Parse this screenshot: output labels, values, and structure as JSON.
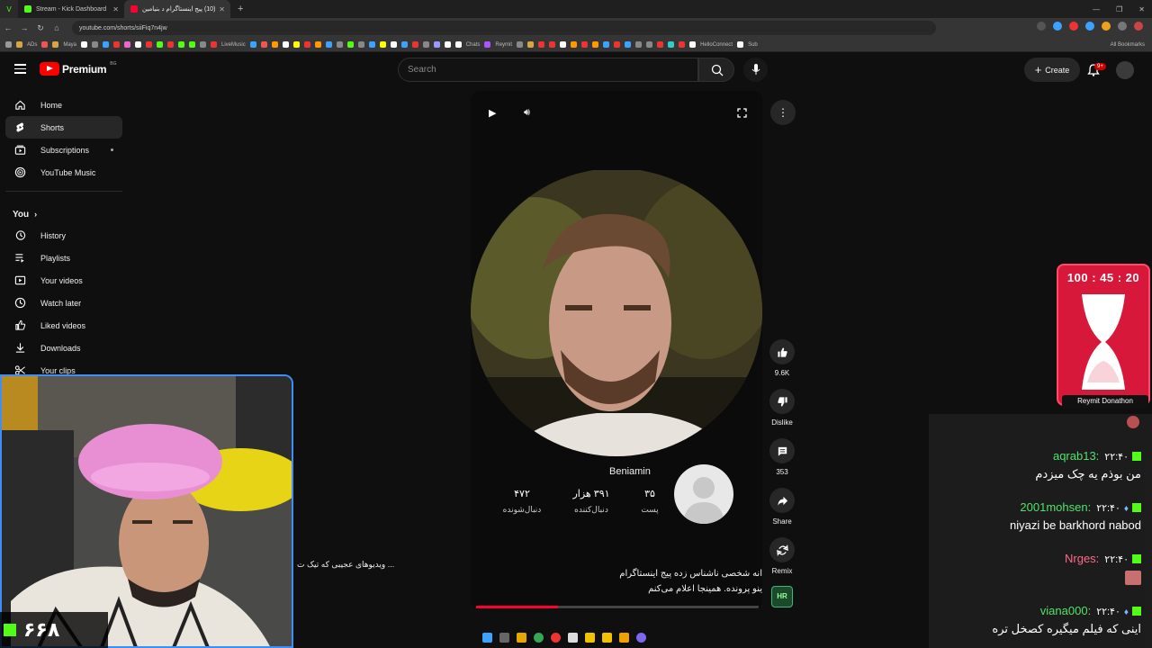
{
  "browser": {
    "tabs": [
      {
        "label": "Stream - Kick Dashboard",
        "color": "#53fc18",
        "active": false
      },
      {
        "label": "(10) پیج اینستاگرام د بنیامین",
        "color": "#ff0033",
        "active": true
      }
    ],
    "url": "youtube.com/shorts/siiFiq7n4jw",
    "bookmarks": [
      "ADs",
      "Maya",
      "LiveMusic",
      "Chats",
      "Reymit",
      "HelloConnect",
      "Sub",
      "All Bookmarks"
    ]
  },
  "header": {
    "logo_text": "Premium",
    "logo_region": "BG",
    "search_placeholder": "Search",
    "create_label": "Create",
    "notif_badge": "9+"
  },
  "sidebar": {
    "main": [
      {
        "label": "Home",
        "icon": "home-icon"
      },
      {
        "label": "Shorts",
        "icon": "shorts-icon",
        "active": true
      },
      {
        "label": "Subscriptions",
        "icon": "subscriptions-icon"
      },
      {
        "label": "YouTube Music",
        "icon": "youtube-music-icon"
      }
    ],
    "you_label": "You",
    "you": [
      {
        "label": "History",
        "icon": "history-icon"
      },
      {
        "label": "Playlists",
        "icon": "playlists-icon"
      },
      {
        "label": "Your videos",
        "icon": "your-videos-icon"
      },
      {
        "label": "Watch later",
        "icon": "watch-later-icon"
      },
      {
        "label": "Liked videos",
        "icon": "liked-videos-icon"
      },
      {
        "label": "Downloads",
        "icon": "downloads-icon"
      },
      {
        "label": "Your clips",
        "icon": "your-clips-icon"
      }
    ]
  },
  "short": {
    "profile_name": "Beniamin",
    "stats": [
      {
        "value": "۳۵",
        "label": "پست"
      },
      {
        "value": "۳۹۱ هزار",
        "label": "دنبال‌کننده"
      },
      {
        "value": "۴۷۲",
        "label": "دنبال‌شونده"
      }
    ],
    "caption_line1": "انه شخصی ناشناس زده پیج اینستاگرام",
    "caption_line2": "ینو پرونده. همینجا اعلام می‌کنم",
    "progress_percent": 29
  },
  "actions": {
    "likes": "9.6K",
    "dislike_label": "Dislike",
    "comments": "353",
    "share_label": "Share",
    "remix_label": "Remix"
  },
  "side_caption": "... ویدیوهای عجیبی که تیک ت",
  "stream": {
    "timer": "100 : 45 : 20",
    "donation_label": "Reymit Donathon",
    "viewer_count": "۶۶۸",
    "chat": [
      {
        "user": "aqrab13:",
        "time": "۲۲:۴۰",
        "text": "من بوذم یه چک میزدم"
      },
      {
        "user": "2001mohsen:",
        "time": "۲۲:۴۰",
        "text": "niyazi be barkhord nabod"
      },
      {
        "user": "Nrges:",
        "time": "۲۲:۴۰",
        "text": ""
      },
      {
        "user": "viana000:",
        "time": "۲۲:۴۰",
        "text": "اینی که فیلم میگیره کصخل تره"
      }
    ]
  },
  "colors": {
    "accent": "#ff0033",
    "kick_green": "#53fc18",
    "timer_red": "#d8183a"
  }
}
